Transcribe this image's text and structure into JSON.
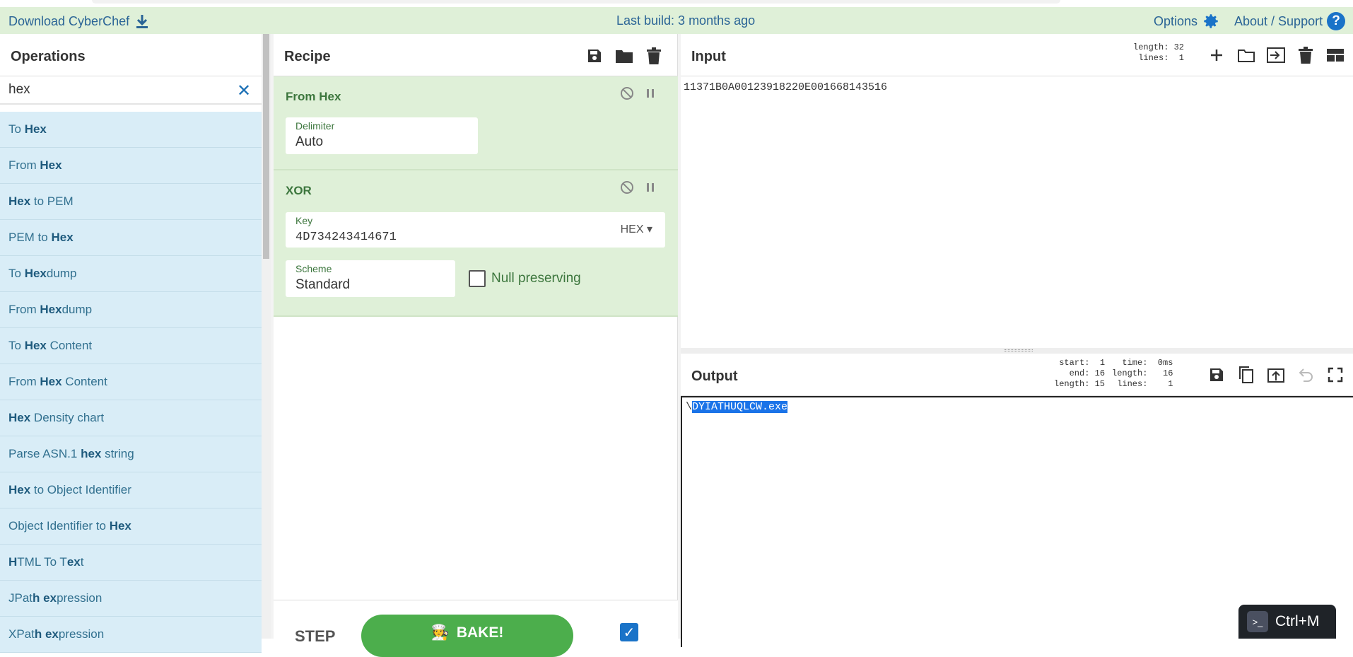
{
  "banner": {
    "download_label": "Download CyberChef",
    "build_label": "Last build: 3 months ago",
    "options_label": "Options",
    "about_label": "About / Support",
    "background": "#dff0d8"
  },
  "operations": {
    "title": "Operations",
    "search_value": "hex",
    "items": [
      {
        "pre": "To ",
        "bold": "Hex",
        "post": ""
      },
      {
        "pre": "From ",
        "bold": "Hex",
        "post": ""
      },
      {
        "pre": "",
        "bold": "Hex",
        "post": " to PEM"
      },
      {
        "pre": "PEM to ",
        "bold": "Hex",
        "post": ""
      },
      {
        "pre": "To ",
        "bold": "Hex",
        "post": "dump"
      },
      {
        "pre": "From ",
        "bold": "Hex",
        "post": "dump"
      },
      {
        "pre": "To ",
        "bold": "Hex",
        "post": " Content"
      },
      {
        "pre": "From ",
        "bold": "Hex",
        "post": " Content"
      },
      {
        "pre": "",
        "bold": "Hex",
        "post": " Density chart"
      },
      {
        "pre": "Parse ASN.1 ",
        "bold": "hex",
        "post": " string"
      },
      {
        "pre": "",
        "bold": "Hex",
        "post": " to Object Identifier"
      },
      {
        "pre": "Object Identifier to ",
        "bold": "Hex",
        "post": ""
      },
      {
        "pre": "",
        "bold": "H",
        "post": "TML To T",
        "bold2": "ex",
        "post2": "t"
      },
      {
        "pre": "JPat",
        "bold": "h ex",
        "post": "pression"
      },
      {
        "pre": "XPat",
        "bold": "h ex",
        "post": "pression"
      }
    ]
  },
  "recipe": {
    "title": "Recipe",
    "ops": [
      {
        "name": "From Hex",
        "fields": [
          {
            "label": "Delimiter",
            "value": "Auto"
          }
        ]
      },
      {
        "name": "XOR",
        "fields": [
          {
            "label": "Key",
            "value": "4D734243414671",
            "format": "HEX"
          },
          {
            "label": "Scheme",
            "value": "Standard"
          }
        ],
        "checkbox_label": "Null preserving"
      }
    ],
    "step_label": "STEP",
    "bake_label": "BAKE!",
    "bake_icon": "🧑‍🍳"
  },
  "input": {
    "title": "Input",
    "stats": "length: 32\n lines:  1",
    "text": "11371B0A00123918220E001668143516"
  },
  "output": {
    "title": "Output",
    "stats_col1": "start:  1\n  end: 16\nlength: 15",
    "stats_col2": "  time:  0ms\nlength:   16\n lines:    1",
    "prefix": "\\",
    "selected": "DYIATHUQLCW.exe"
  },
  "ctrlm": {
    "label": "Ctrl+M",
    "icon": "terminal-icon"
  }
}
